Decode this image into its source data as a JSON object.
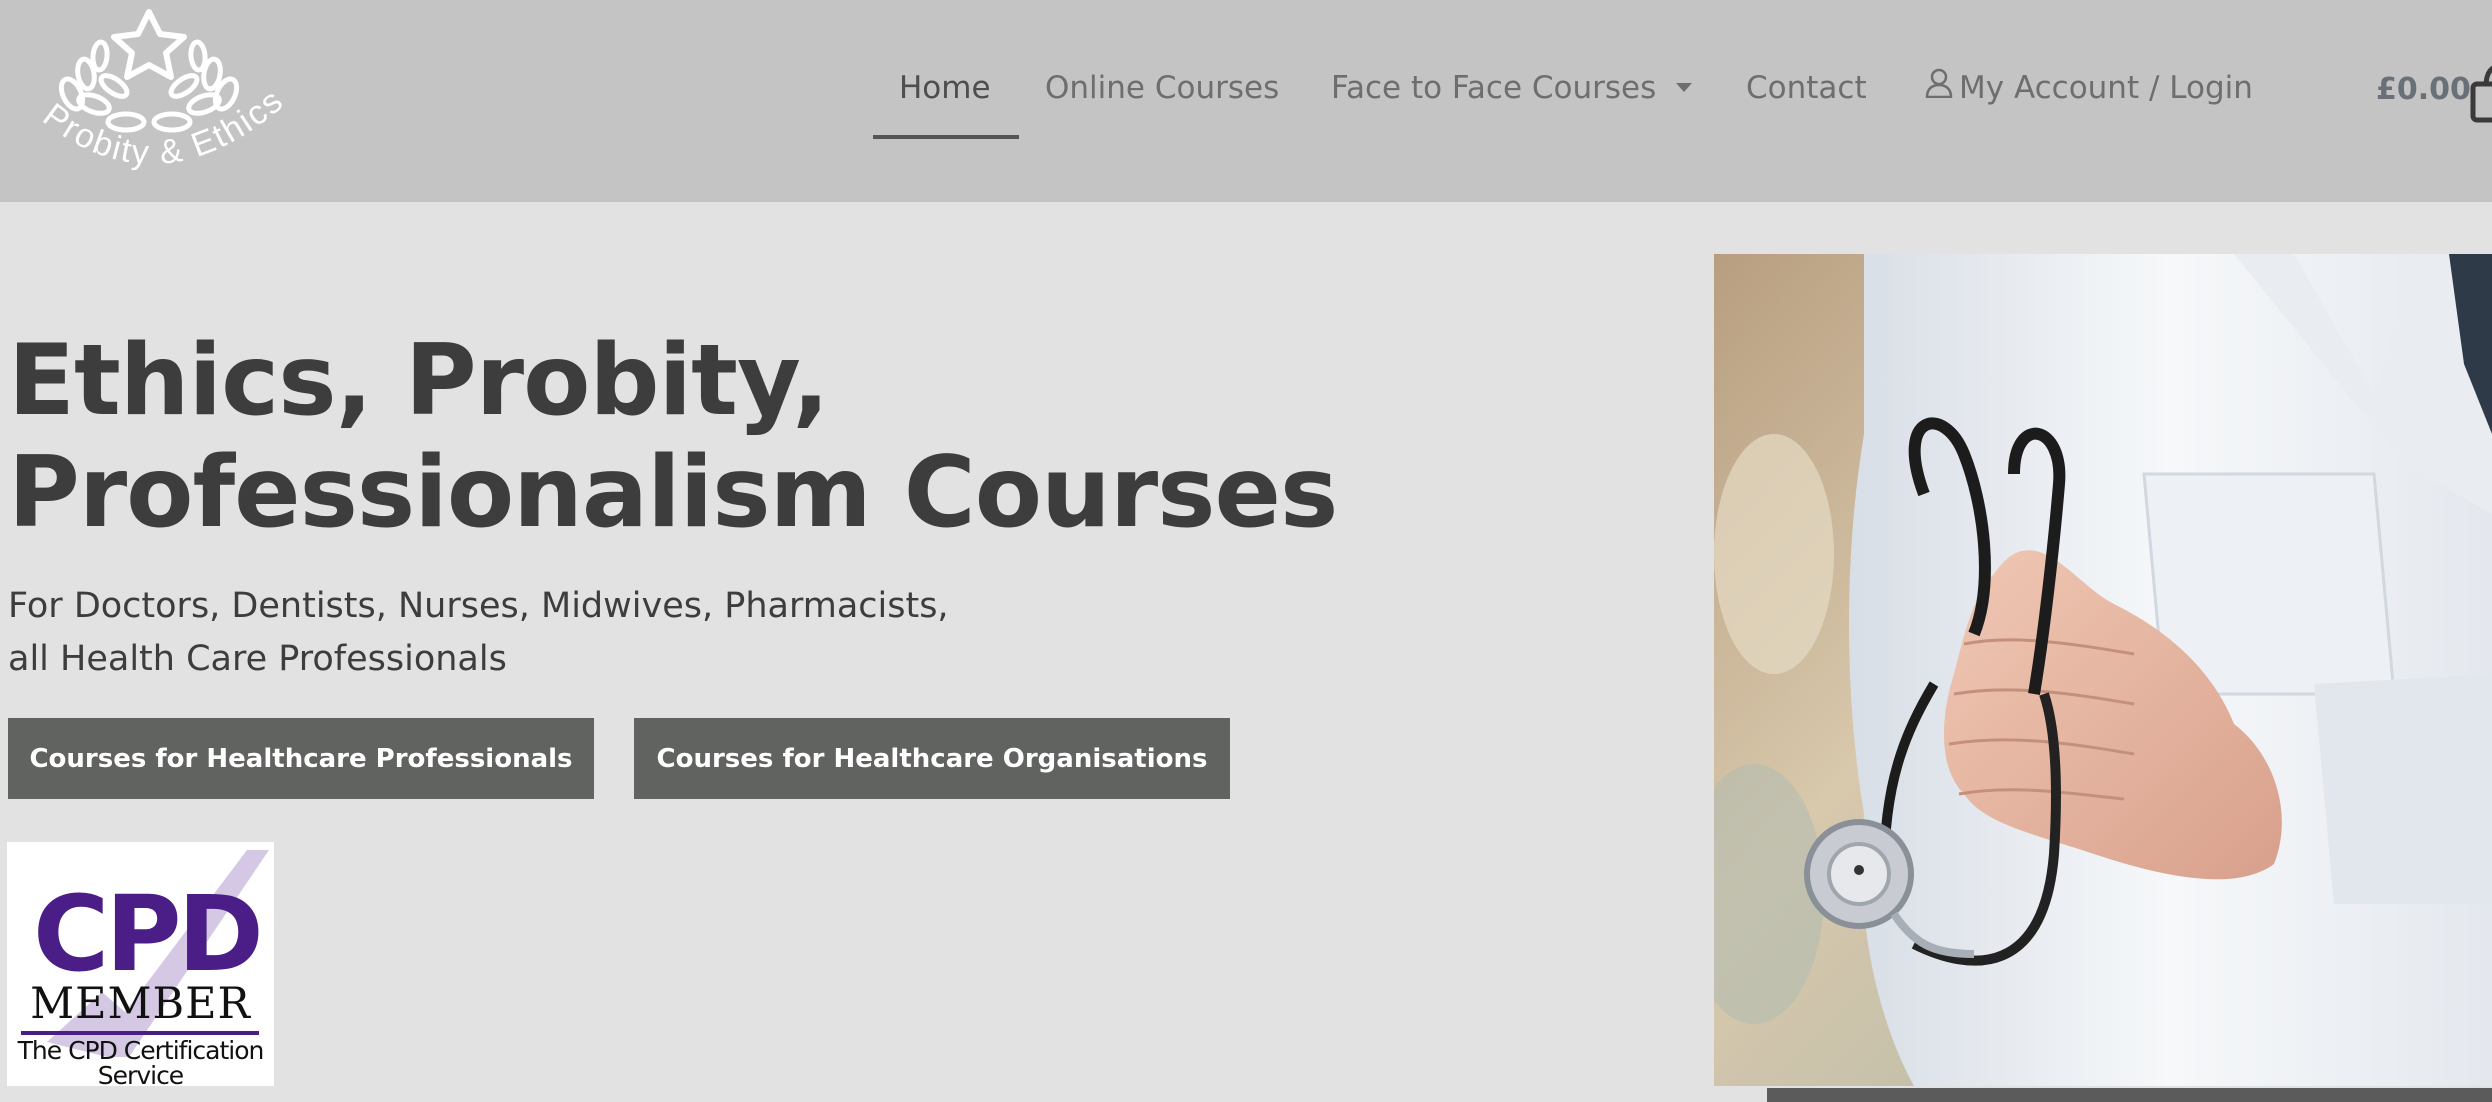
{
  "header": {
    "logo_text": "Probity & Ethics",
    "nav": [
      {
        "label": "Home",
        "active": true
      },
      {
        "label": "Online Courses"
      },
      {
        "label": "Face to Face Courses",
        "has_dropdown": true
      },
      {
        "label": "Contact"
      },
      {
        "label": "My Account / Login",
        "icon": "user-icon"
      }
    ],
    "cart_total": "£0.00",
    "cart_icon": "shopping-bag-icon"
  },
  "hero": {
    "title_line1": "Ethics, Probity,",
    "title_line2": "Professionalism Courses",
    "subtitle_line1": "For Doctors, Dentists, Nurses, Midwives, Pharmacists,",
    "subtitle_line2": "all Health Care Professionals",
    "btn_professionals": "Courses for Healthcare Professionals",
    "btn_organisations": "Courses for Healthcare Organisations"
  },
  "cpd_badge": {
    "logo_text": "CPD",
    "member_text": "MEMBER",
    "caption_line1": "The CPD Certification",
    "caption_line2": "Service"
  },
  "colors": {
    "header_bg": "#c4c4c4",
    "page_bg": "#e2e2e2",
    "button_bg": "#616360",
    "cpd_purple": "#4a1e86"
  }
}
